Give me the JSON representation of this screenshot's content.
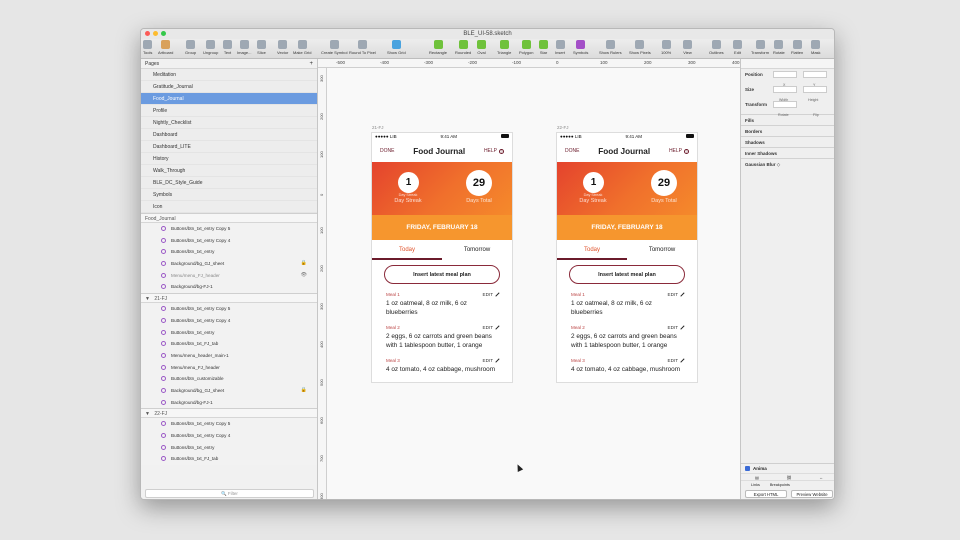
{
  "window": {
    "title": "BLE_UI-58.sketch"
  },
  "toolbar": {
    "items": [
      "Tools",
      "Artboard",
      "Group",
      "Ungroup",
      "Text",
      "Image...",
      "Slice",
      "Vector",
      "Make Grid",
      "Create Symbol",
      "Round To Pixel",
      "Show Grid",
      "Rectangle",
      "Rounded",
      "Oval",
      "Triangle",
      "Polygon",
      "Star",
      "Insert",
      "Symbols",
      "Show Rulers",
      "Show Pixels",
      "100%",
      "View",
      "Outlines",
      "Edit",
      "Transform",
      "Rotate",
      "Flatten",
      "Mask"
    ]
  },
  "sidebar": {
    "pages_label": "Pages",
    "pages": [
      {
        "label": "Meditation"
      },
      {
        "label": "Gratitude_Journal"
      },
      {
        "label": "Food_Journal",
        "selected": true
      },
      {
        "label": "Profile"
      },
      {
        "label": "Nightly_Checklist"
      },
      {
        "label": "Dashboard"
      },
      {
        "label": "Dashboard_LITE"
      },
      {
        "label": "History"
      },
      {
        "label": "Walk_Through"
      },
      {
        "label": "BLE_DC_Style_Guide"
      },
      {
        "label": "Symbols"
      },
      {
        "label": "Icon"
      }
    ],
    "layers_title": "Food_Journal",
    "group0": [
      {
        "label": "Buttons/btn_txt_entry Copy 5"
      },
      {
        "label": "Buttons/btn_txt_entry Copy 4"
      },
      {
        "label": "Buttons/btn_txt_entry"
      },
      {
        "label": "Background/bg_GJ_sheet",
        "tail": "🔒"
      },
      {
        "label": "Menu/menu_FJ_header",
        "tail": "👁",
        "dim": true
      },
      {
        "label": "Background/bg-FJ-1"
      }
    ],
    "group1_label": "21-FJ",
    "group1": [
      {
        "label": "Buttons/btn_txt_entry Copy 5"
      },
      {
        "label": "Buttons/btn_txt_entry Copy 4"
      },
      {
        "label": "Buttons/btn_txt_entry"
      },
      {
        "label": "Buttons/btn_txt_FJ_tab"
      },
      {
        "label": "Menu/menu_header_main-1"
      },
      {
        "label": "Menu/menu_FJ_header"
      },
      {
        "label": "Buttons/btn_customizable"
      },
      {
        "label": "Background/bg_GJ_sheet",
        "tail": "🔒"
      },
      {
        "label": "Background/bg-FJ-1"
      }
    ],
    "group2_label": "22-FJ",
    "group2": [
      {
        "label": "Buttons/btn_txt_entry Copy 5"
      },
      {
        "label": "Buttons/btn_txt_entry Copy 4"
      },
      {
        "label": "Buttons/btn_txt_entry"
      },
      {
        "label": "Buttons/btn_txt_FJ_tab"
      }
    ],
    "filter_placeholder": "Filter"
  },
  "rulers": {
    "top": [
      "-500",
      "-400",
      "-300",
      "-200",
      "-100",
      "0",
      "100",
      "200",
      "300",
      "400"
    ],
    "left": [
      "300",
      "200",
      "100",
      "0",
      "100",
      "200",
      "300",
      "400",
      "500",
      "600",
      "700",
      "800"
    ]
  },
  "artboards": [
    {
      "label": "21-FJ"
    },
    {
      "label": "22-FJ"
    }
  ],
  "app": {
    "status": {
      "carrier": "●●●●● LIB",
      "time": "9:41 AM"
    },
    "done": "DONE",
    "title": "Food Journal",
    "help": "HELP",
    "streak_value": "1",
    "streak_label": "Day Streak",
    "total_value": "29",
    "total_label": "Days Total",
    "date": "FRIDAY, FEBRUARY 18",
    "tab_today": "Today",
    "tab_tomorrow": "Tomorrow",
    "insert": "Insert latest meal plan",
    "edit": "EDIT",
    "meals": [
      {
        "label": "Meal 1",
        "desc": "1 oz oatmeal, 8 oz milk, 6 oz blueberries"
      },
      {
        "label": "Meal 2",
        "desc": "2 eggs, 6 oz carrots and green beans with 1 tablespoon butter, 1 orange"
      },
      {
        "label": "Meal 3",
        "desc": "4 oz tomato, 4 oz cabbage, mushroom"
      }
    ]
  },
  "inspector": {
    "position": "Position",
    "x": "X",
    "y": "Y",
    "size": "Size",
    "width": "Width",
    "height": "Height",
    "transform": "Transform",
    "rotate": "Rotate",
    "flip": "Flip",
    "sections": [
      "Fills",
      "Borders",
      "Shadows",
      "Inner Shadows",
      "Gaussian Blur ◇"
    ]
  },
  "anima": {
    "title": "Anima",
    "links": "Links",
    "breakpoints": "Breakpoints",
    "export": "Export HTML",
    "preview": "Preview Website"
  }
}
